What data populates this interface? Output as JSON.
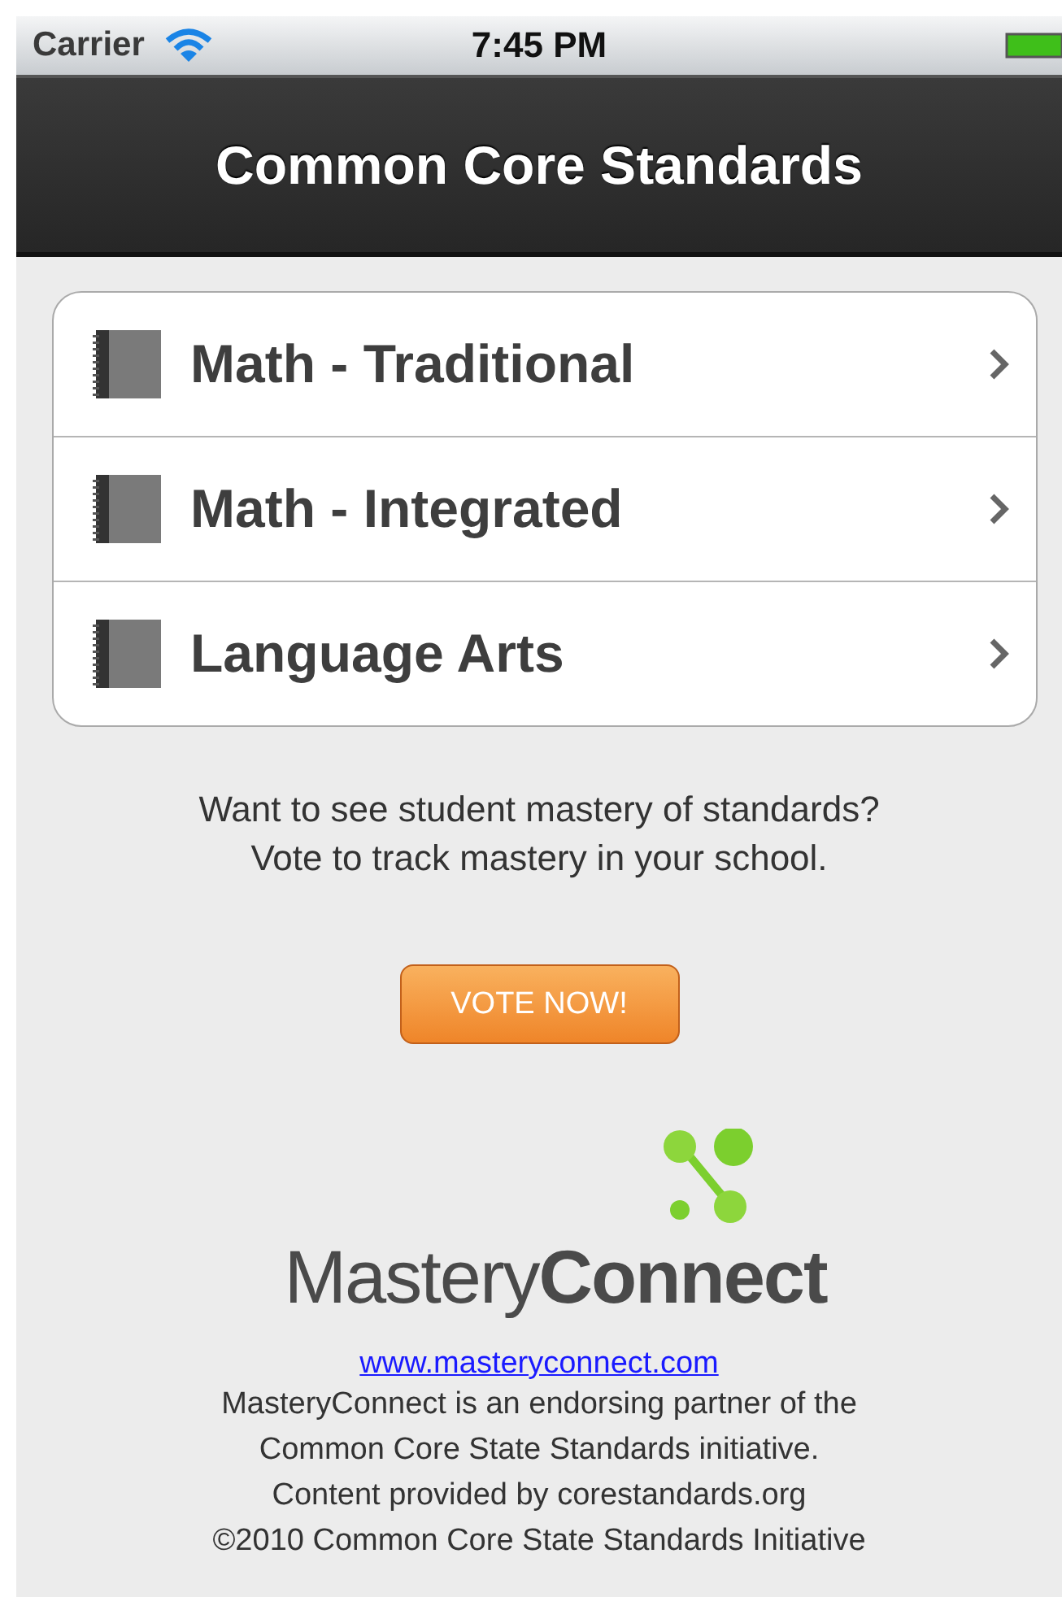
{
  "status_bar": {
    "carrier": "Carrier",
    "time": "7:45 PM"
  },
  "nav_bar": {
    "title": "Common Core Standards"
  },
  "menu": [
    {
      "label": "Math - Traditional"
    },
    {
      "label": "Math - Integrated"
    },
    {
      "label": "Language Arts"
    }
  ],
  "promo": {
    "lines": [
      "Want to see student mastery of standards?",
      "Vote to track mastery in your school."
    ],
    "button": "VOTE NOW!"
  },
  "footer": {
    "logo": "Mastery**Connect**",
    "link": "www.masteryconnect.com",
    "lines": [
      "MasteryConnect is an endorsing partner of the",
      "Common Core State Standards initiative.",
      "Content provided by corestandards.org",
      "©2010 Common Core State Standards Initiative"
    ]
  }
}
